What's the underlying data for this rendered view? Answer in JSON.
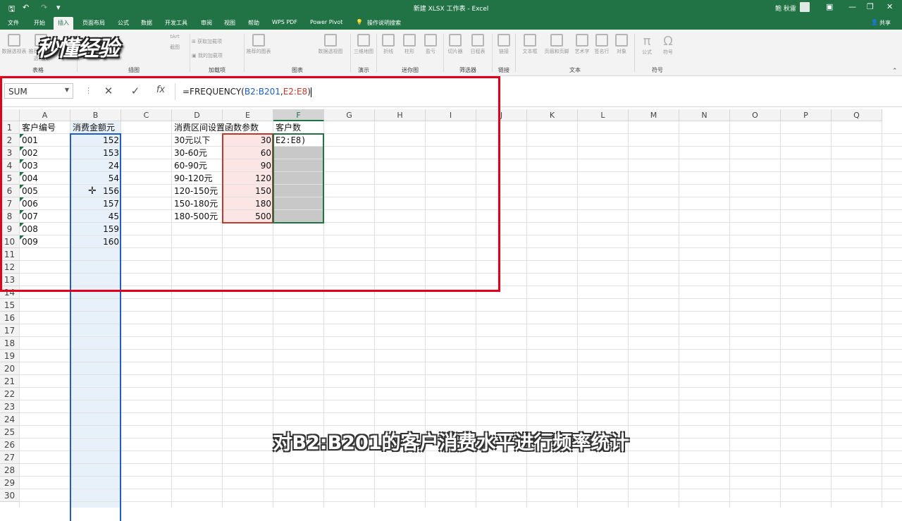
{
  "titlebar": {
    "title": "新建 XLSX 工作表 - Excel",
    "user": "鲍 秋雷",
    "save_icon": "save-icon",
    "undo_icon": "undo-icon"
  },
  "tabs": [
    "文件",
    "开始",
    "插入",
    "页面布局",
    "公式",
    "数据",
    "开发工具",
    "审阅",
    "视图",
    "帮助",
    "WPS PDF",
    "Power Pivot"
  ],
  "active_tab": "插入",
  "tell_me": "操作说明搜索",
  "share": "共享",
  "ribbon": {
    "groups": [
      "表格",
      "插图",
      "加载项",
      "图表",
      "演示",
      "迷你图",
      "筛选器",
      "链接",
      "文本",
      "符号"
    ],
    "buttons": [
      "数据透视表",
      "推荐的数据透视表",
      "获取加载项",
      "我的加载项",
      "推荐的图表",
      "数据透视图",
      "三维地图",
      "折线",
      "柱形",
      "盈亏",
      "切片器",
      "日程表",
      "链接",
      "文本框",
      "页眉和页脚",
      "艺术字",
      "签名行",
      "对象",
      "公式",
      "符号"
    ],
    "art_label": "tArt",
    "shot_label": "截图"
  },
  "watermark": "秒懂经验",
  "formula_bar": {
    "name_box": "SUM",
    "cancel": "✕",
    "enter": "✓",
    "fx": "fx",
    "prefix": "=FREQUENCY(",
    "ref1": "B2:B201",
    "comma": ",",
    "ref2": "E2:E8",
    "suffix": ")"
  },
  "columns": [
    "A",
    "B",
    "C",
    "D",
    "E",
    "F",
    "G",
    "H",
    "I",
    "J",
    "K",
    "L",
    "M",
    "N",
    "O",
    "P",
    "Q"
  ],
  "rows": [
    "1",
    "2",
    "3",
    "4",
    "5",
    "6",
    "7",
    "8",
    "9",
    "10",
    "11",
    "12",
    "13",
    "14",
    "15",
    "16",
    "17",
    "18",
    "19",
    "20",
    "21",
    "22",
    "23",
    "24",
    "25",
    "26",
    "27",
    "28",
    "29",
    "30"
  ],
  "cells": {
    "A": [
      "客户编号",
      "001",
      "002",
      "003",
      "004",
      "005",
      "006",
      "007",
      "008",
      "009"
    ],
    "B": [
      "消费金额元",
      "152",
      "153",
      "24",
      "54",
      "156",
      "157",
      "45",
      "159",
      "160"
    ],
    "D": [
      "消费区间设置",
      "30元以下",
      "30-60元",
      "60-90元",
      "90-120元",
      "120-150元",
      "150-180元",
      "180-500元"
    ],
    "E": [
      "函数参数",
      "30",
      "60",
      "90",
      "120",
      "150",
      "180",
      "500"
    ],
    "F": [
      "客户数",
      "E2:E8)"
    ]
  },
  "subtitle": "对B2:B201的客户消费水平进行频率统计",
  "colors": {
    "excel_green": "#217346",
    "highlight_red": "#e0001b",
    "range_blue": "#1f5dc7"
  }
}
